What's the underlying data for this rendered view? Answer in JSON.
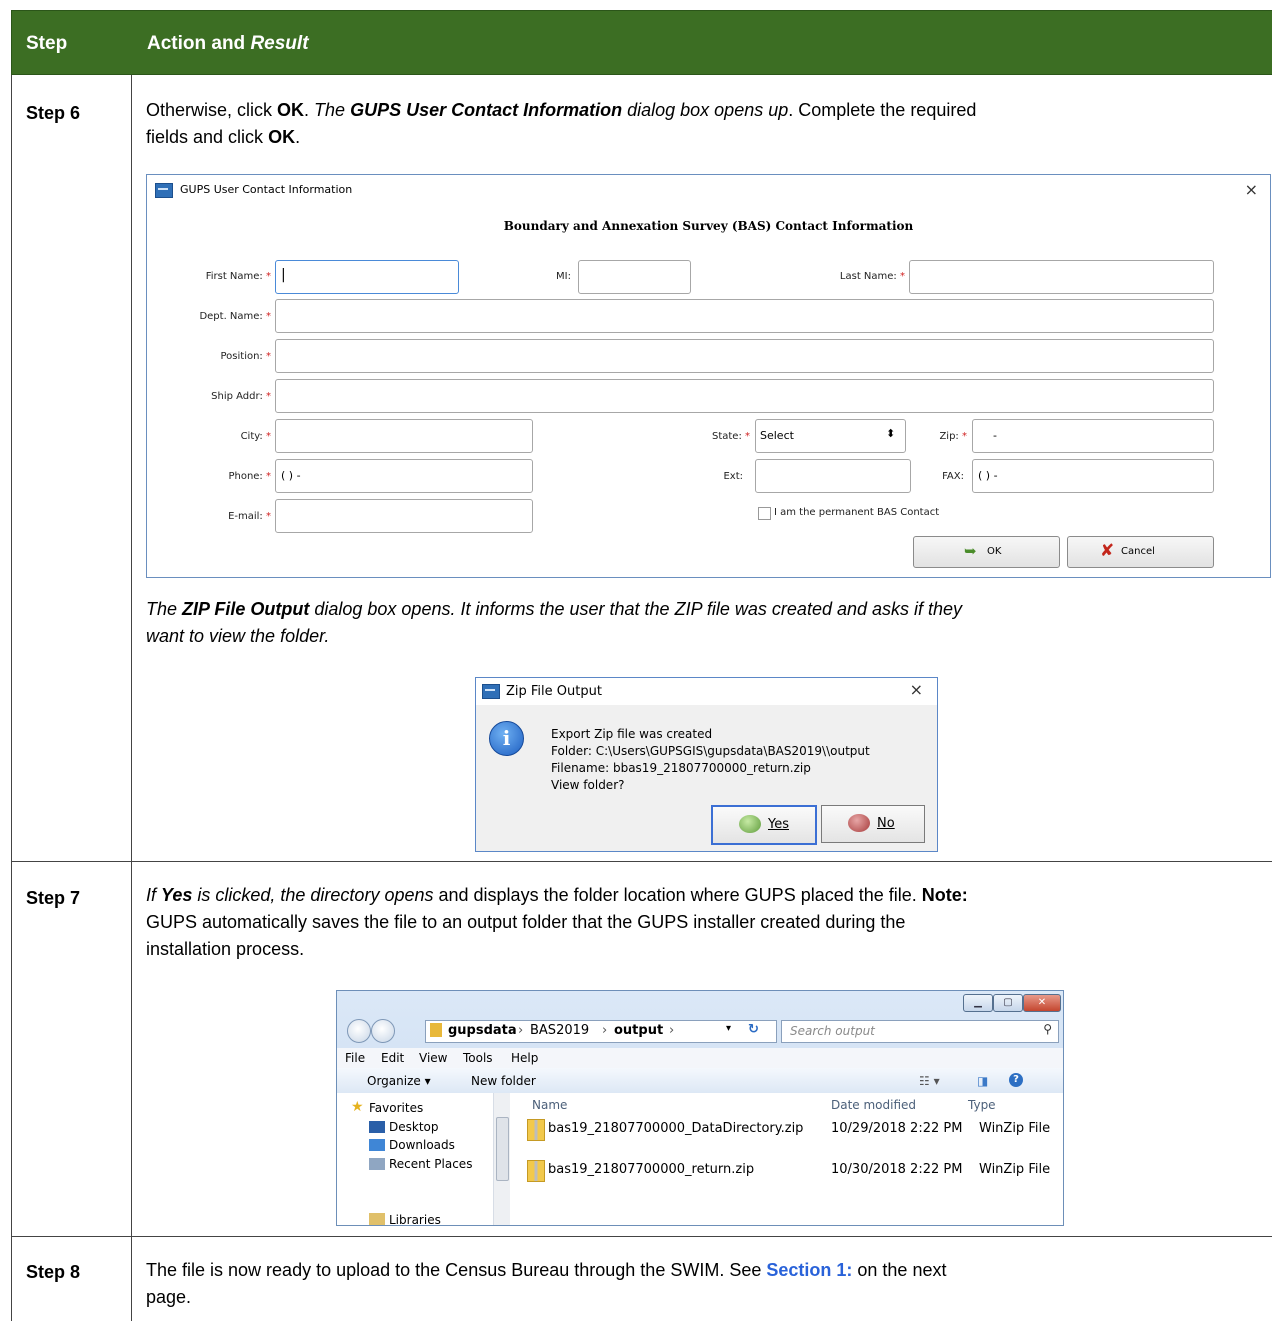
{
  "table": {
    "header_step": "Step",
    "header_action": "Action and",
    "header_result": "Result",
    "rows": [
      {
        "step": "Step 6",
        "p1_a": "Otherwise, click ",
        "p1_b": "OK",
        "p1_c": ". ",
        "p1_d": "The ",
        "p1_e": "GUPS User Contact Information",
        "p1_f": " dialog box opens up",
        "p1_g": ". Complete the required",
        "p2_a": "fields and click ",
        "p2_b": "OK",
        "p2_c": ".",
        "zip_a": "The ",
        "zip_b": "ZIP File Output",
        "zip_c": " dialog box opens. It informs the user that the ZIP file was created and asks if they",
        "zip_d": "want to view the folder."
      },
      {
        "step": "Step 7",
        "l1_a": "If ",
        "l1_b": "Yes",
        "l1_c": " is clicked, the directory opens",
        "l1_d": " and displays the folder location where GUPS placed the file. ",
        "l1_e": "Note:",
        "l2": "GUPS automatically saves the file to an output folder that the GUPS installer created during the",
        "l3": "installation process."
      },
      {
        "step": "Step 8",
        "l1_a": "The file is now ready to upload to the Census Bureau through the SWIM. See ",
        "l1_link": "Section 1:",
        "l1_b": " on the next",
        "l2": "page."
      }
    ]
  },
  "contact_dialog": {
    "title": "GUPS User Contact Information",
    "heading": "Boundary and Annexation Survey (BAS) Contact Information",
    "labels": {
      "first_name": "First Name:",
      "mi": "MI:",
      "last_name": "Last Name:",
      "dept_name": "Dept. Name:",
      "position": "Position:",
      "ship_addr": "Ship Addr:",
      "city": "City:",
      "state": "State:",
      "zip": "Zip:",
      "phone": "Phone:",
      "ext": "Ext:",
      "fax": "FAX:",
      "email": "E-mail:"
    },
    "required_mark": "*",
    "state_value": "Select",
    "zip_value": "-",
    "phone_value": "( )  -",
    "fax_value": "( )  -",
    "checkbox_label": "I am the permanent BAS Contact",
    "ok_label": "OK",
    "cancel_label": "Cancel",
    "close_glyph": "×"
  },
  "zip_dialog": {
    "title": "Zip File Output",
    "close_glyph": "×",
    "msg1": "Export Zip file was created",
    "msg2": "Folder: C:\\Users\\GUPSGIS\\gupsdata\\BAS2019\\\\output",
    "msg3": "Filename: bbas19_21807700000_return.zip",
    "msg4": "View folder?",
    "yes_label": "Yes",
    "no_label": "No"
  },
  "explorer": {
    "path": [
      "gupsdata",
      "BAS2019",
      "output"
    ],
    "search_placeholder": "Search output",
    "menu": [
      "File",
      "Edit",
      "View",
      "Tools",
      "Help"
    ],
    "organize": "Organize ▾",
    "new_folder": "New folder",
    "nav": {
      "favorites": "Favorites",
      "desktop": "Desktop",
      "downloads": "Downloads",
      "recent": "Recent Places",
      "libraries": "Libraries"
    },
    "columns": {
      "name": "Name",
      "date": "Date modified",
      "type": "Type"
    },
    "files": [
      {
        "name": "bas19_21807700000_DataDirectory.zip",
        "date": "10/29/2018 2:22 PM",
        "type": "WinZip File"
      },
      {
        "name": "bas19_21807700000_return.zip",
        "date": "10/30/2018 2:22 PM",
        "type": "WinZip File"
      }
    ]
  }
}
